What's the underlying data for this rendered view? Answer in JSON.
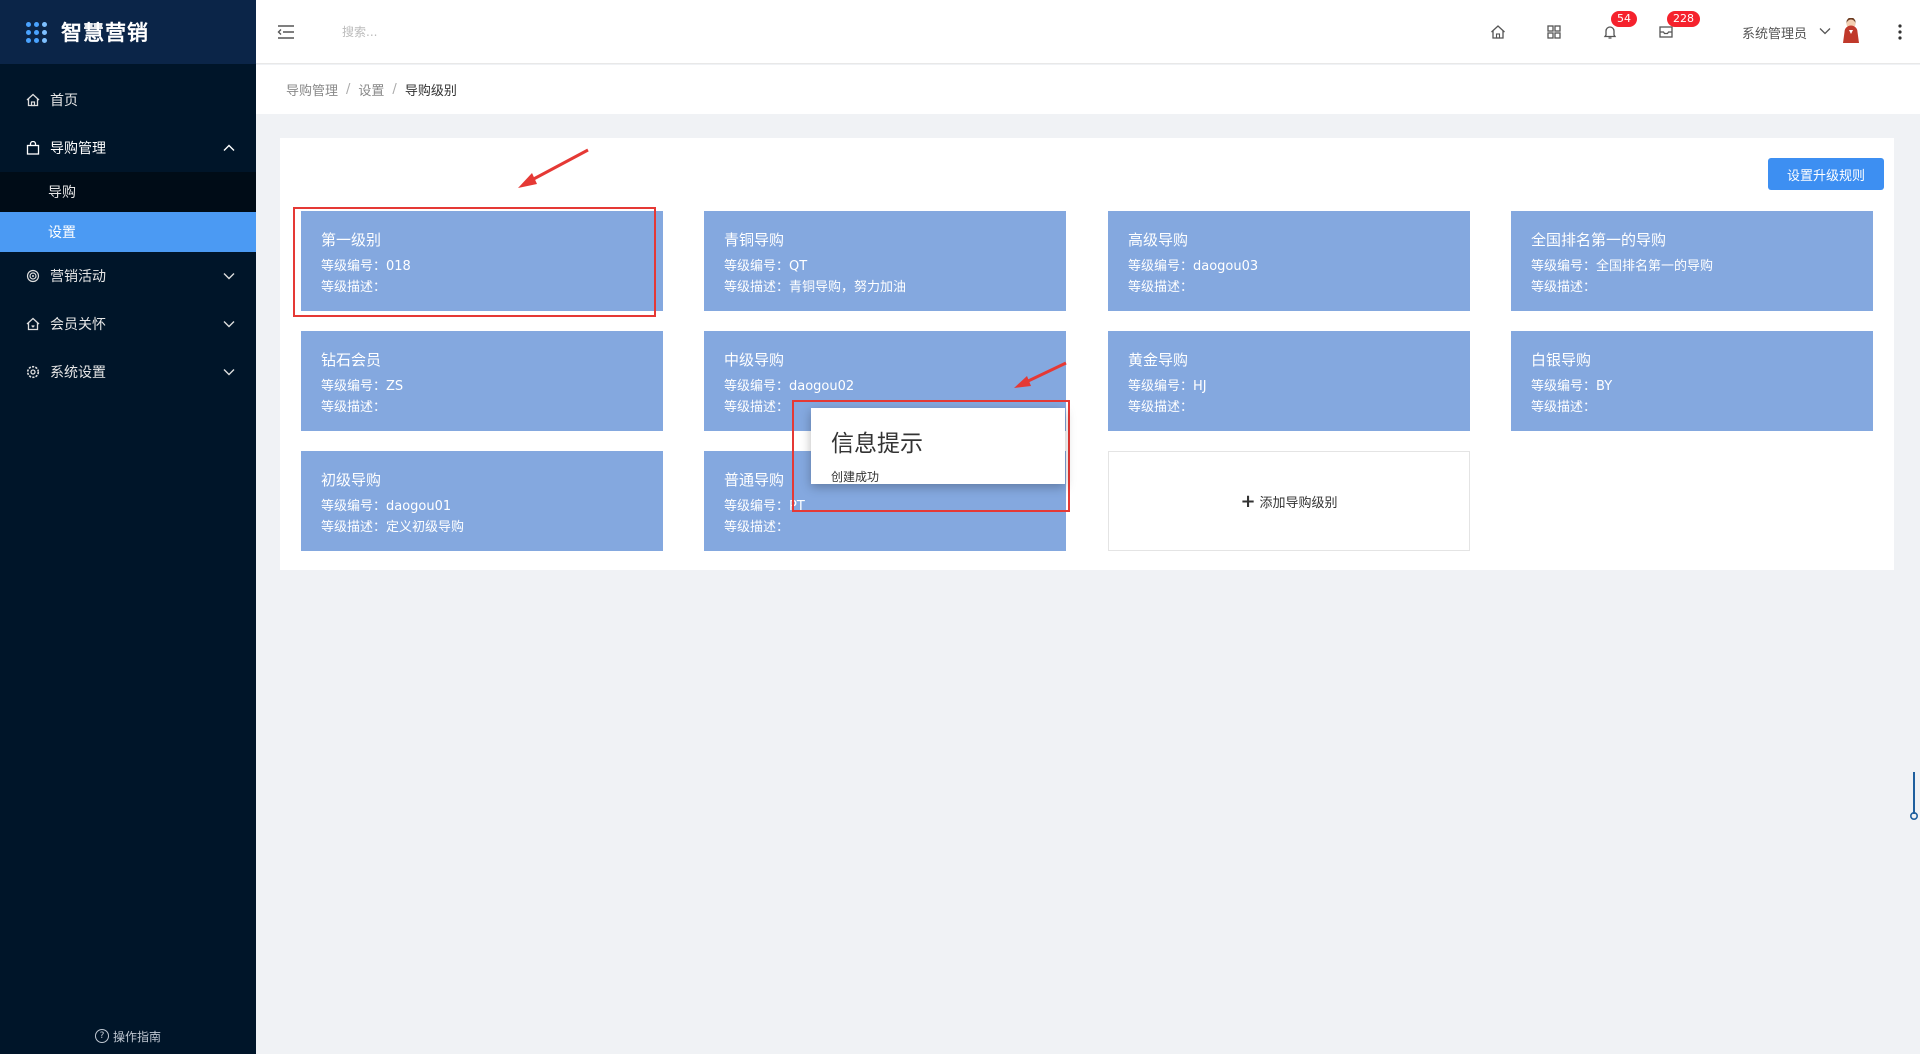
{
  "app": {
    "title": "智慧营销"
  },
  "sidebar": {
    "menu": [
      {
        "label": "首页",
        "icon": "home-icon"
      },
      {
        "label": "导购管理",
        "icon": "shopping-bag-icon",
        "open": true,
        "children": [
          {
            "label": "导购"
          },
          {
            "label": "设置",
            "active": true
          }
        ]
      },
      {
        "label": "营销活动",
        "icon": "target-icon"
      },
      {
        "label": "会员关怀",
        "icon": "house-heart-icon"
      },
      {
        "label": "系统设置",
        "icon": "gear-icon"
      }
    ],
    "footer": "操作指南"
  },
  "header": {
    "search_placeholder": "搜索...",
    "notifications_count": "54",
    "messages_count": "228",
    "user_name": "系统管理员"
  },
  "breadcrumb": [
    "导购管理",
    "设置",
    "导购级别"
  ],
  "toolbar": {
    "upgrade_rules_label": "设置升级规则"
  },
  "levels": [
    {
      "name": "第一级别",
      "code": "等级编号：018",
      "desc": "等级描述："
    },
    {
      "name": "青铜导购",
      "code": "等级编号：QT",
      "desc": "等级描述：青铜导购，努力加油"
    },
    {
      "name": "高级导购",
      "code": "等级编号：daogou03",
      "desc": "等级描述："
    },
    {
      "name": "全国排名第一的导购",
      "code": "等级编号：全国排名第一的导购",
      "desc": "等级描述："
    },
    {
      "name": "钻石会员",
      "code": "等级编号：ZS",
      "desc": "等级描述："
    },
    {
      "name": "中级导购",
      "code": "等级编号：daogou02",
      "desc": "等级描述："
    },
    {
      "name": "黄金导购",
      "code": "等级编号：HJ",
      "desc": "等级描述："
    },
    {
      "name": "白银导购",
      "code": "等级编号：BY",
      "desc": "等级描述："
    },
    {
      "name": "初级导购",
      "code": "等级编号：daogou01",
      "desc": "等级描述：定义初级导购"
    },
    {
      "name": "普通导购",
      "code": "等级编号：PT",
      "desc": "等级描述："
    }
  ],
  "add_card": {
    "label": "添加导购级别"
  },
  "message": {
    "title": "信息提示",
    "body": "创建成功"
  },
  "colors": {
    "sidebar_bg": "#001529",
    "active_item": "#4b9af3",
    "card_bg": "#84a8df",
    "primary": "#3d8ff2",
    "annotation": "#e53935"
  }
}
